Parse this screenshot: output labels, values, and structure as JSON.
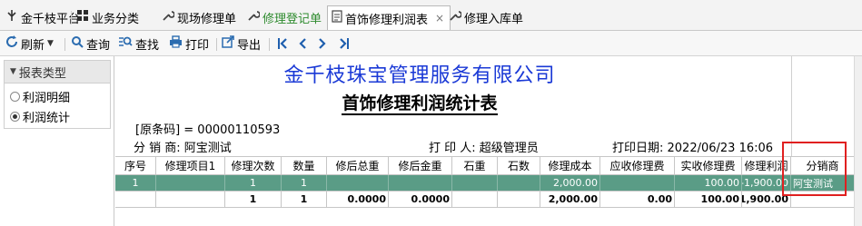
{
  "tabs": [
    {
      "label": "金千枝平台",
      "icon": "app-logo-icon"
    },
    {
      "label": "业务分类",
      "icon": "grid-icon"
    },
    {
      "label": "现场修理单",
      "icon": "wrench-icon"
    },
    {
      "label": "修理登记单",
      "icon": "wrench-icon"
    },
    {
      "label": "首饰修理利润表",
      "icon": "document-icon",
      "close": "×"
    },
    {
      "label": "修理入库单",
      "icon": "wrench-icon"
    }
  ],
  "toolbar": {
    "refresh": "刷新",
    "query": "查询",
    "find": "查找",
    "print": "打印",
    "export": "导出"
  },
  "left_panel": {
    "header": "报表类型",
    "options": [
      {
        "label": "利润明细",
        "checked": false
      },
      {
        "label": "利润统计",
        "checked": true
      }
    ]
  },
  "report": {
    "company": "金千枝珠宝管理服务有限公司",
    "title": "首饰修理利润统计表",
    "barcode_line": "[原条码] = 00000110593",
    "distributor_line": "分 销 商: 阿宝测试",
    "printer_line": "打 印 人: 超级管理员",
    "print_date_line": "打印日期: 2022/06/23 16:06"
  },
  "table": {
    "headers": [
      "序号",
      "修理项目1",
      "修理次数",
      "数量",
      "修后总重",
      "修后金重",
      "石重",
      "石数",
      "修理成本",
      "应收修理费",
      "实收修理费",
      "修理利润",
      "分销商"
    ],
    "rows": [
      [
        "1",
        "",
        "1",
        "1",
        "",
        "",
        "",
        "",
        "2,000.00",
        "",
        "100.00",
        "-1,900.00",
        "阿宝测试"
      ],
      [
        "",
        "",
        "1",
        "1",
        "0.0000",
        "0.0000",
        "",
        "",
        "2,000.00",
        "0.00",
        "100.00",
        "-1,900.00",
        ""
      ]
    ]
  },
  "colors": {
    "company_blue": "#1a39d6",
    "selected_row": "#5a9c86",
    "highlight_red": "#e02020"
  }
}
